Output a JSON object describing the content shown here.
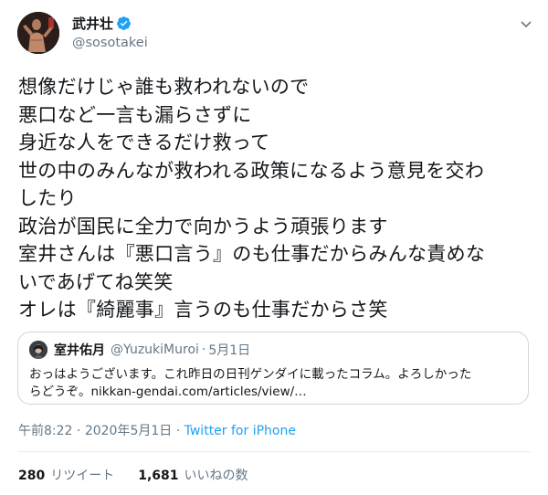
{
  "author": {
    "display_name": "武井壮",
    "handle": "@sosotakei",
    "verified": true,
    "avatar_icon": "profile-photo-icon",
    "menu_icon": "chevron-down-icon"
  },
  "tweet": {
    "lines": [
      "想像だけじゃ誰も救われないので",
      "悪口など一言も漏らさずに",
      "身近な人をできるだけ救って",
      "世の中のみんなが救われる政策になるよう意見を交わ",
      "したり",
      "政治が国民に全力で向かうよう頑張ります",
      "室井さんは『悪口言う』のも仕事だからみんな責めな",
      "いであげてね笑笑",
      "オレは『綺麗事』言うのも仕事だからさ笑"
    ]
  },
  "quoted_tweet": {
    "display_name": "室井佑月",
    "handle": "@YuzukiMuroi",
    "separator": "·",
    "date": "5月1日",
    "text_lines": [
      "おっはようございます。これ昨日の日刊ゲンダイに載ったコラム。よろしかった",
      "らどうぞ。nikkan-gendai.com/articles/view/…"
    ]
  },
  "meta": {
    "time": "午前8:22",
    "separator1": "·",
    "date": "2020年5月1日",
    "separator2": "·",
    "source": "Twitter for iPhone"
  },
  "stats": {
    "retweets_count": "280",
    "retweets_label": "リツイート",
    "likes_count": "1,681",
    "likes_label": "いいねの数"
  },
  "colors": {
    "text": "#14171a",
    "secondary": "#657786",
    "link": "#1da1f2",
    "verified": "#1da1f2",
    "border": "#ccd6dd"
  }
}
